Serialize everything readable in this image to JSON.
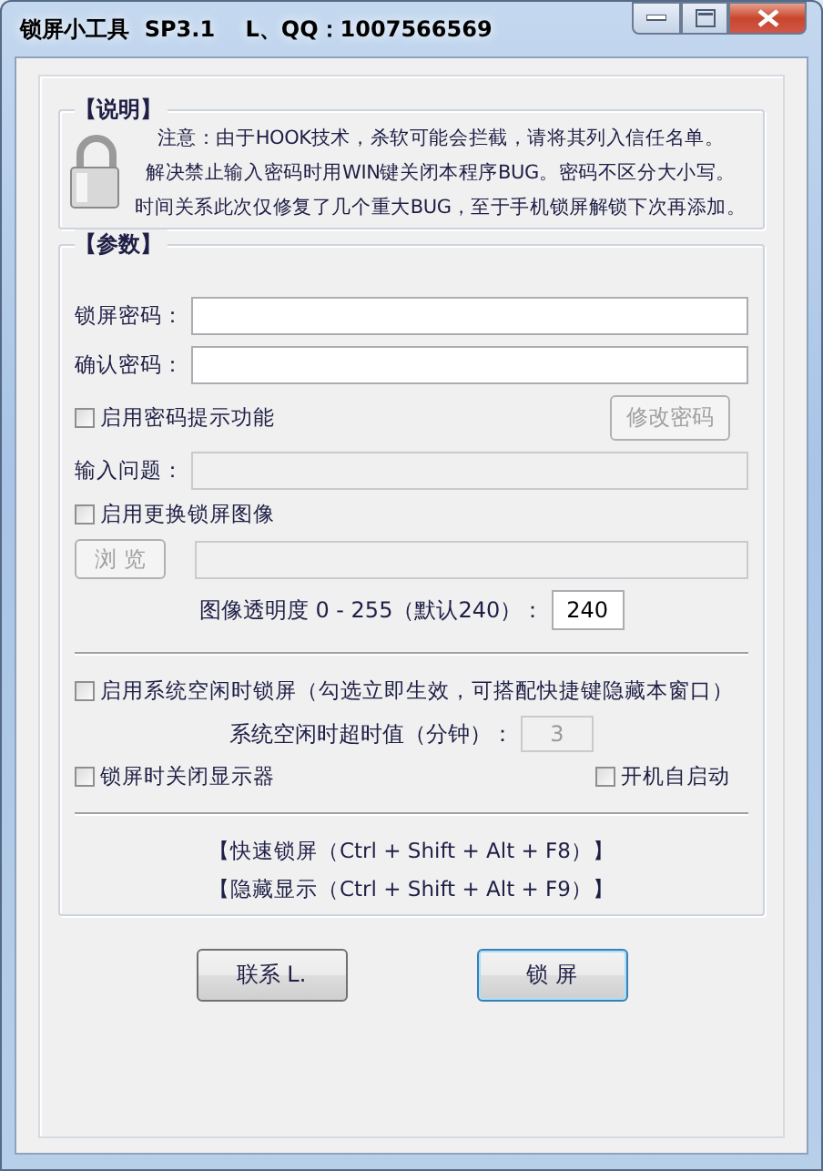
{
  "window": {
    "title": "锁屏小工具  SP3.1    L、QQ：1007566569"
  },
  "about": {
    "title": "【说明】",
    "lines": [
      "注意：由于HOOK技术，杀软可能会拦截，请将其列入信任名单。",
      "解决禁止输入密码时用WIN键关闭本程序BUG。密码不区分大小写。",
      "时间关系此次仅修复了几个重大BUG，至于手机锁屏解锁下次再添加。"
    ]
  },
  "params": {
    "title": "【参数】",
    "password_field": {
      "label": "锁屏密码：",
      "disabled": false
    },
    "confirm_field": {
      "label": "确认密码：",
      "disabled": false
    },
    "hint_option": {
      "label": "启用密码提示功能",
      "checked": false
    },
    "change_password_button": {
      "label": "修改密码",
      "disabled": true
    },
    "question_field": {
      "label": "输入问题：",
      "disabled": true
    },
    "image_option": {
      "label": "启用更换锁屏图像",
      "checked": false
    },
    "browse_button": {
      "label": "浏 览",
      "disabled": true
    },
    "image_path_field": {
      "disabled": true
    },
    "opacity": {
      "label": "图像透明度 0 - 255（默认240）：",
      "value": "240",
      "disabled": false
    },
    "idle_option": {
      "label": "启用系统空闲时锁屏（勾选立即生效，可搭配快捷键隐藏本窗口）",
      "checked": false
    },
    "idle_timeout": {
      "label": "系统空闲时超时值（分钟）：",
      "value": "3",
      "disabled": true
    },
    "monitor_off_option": {
      "label": "锁屏时关闭显示器",
      "checked": false
    },
    "autostart_option": {
      "label": "开机自启动",
      "checked": false
    },
    "hotkeys": [
      "【快速锁屏（Ctrl + Shift + Alt + F8）】",
      "【隐藏显示（Ctrl + Shift + Alt + F9）】"
    ]
  },
  "buttons": [
    {
      "label": "联系 L.",
      "default": false
    },
    {
      "label": "锁 屏",
      "default": true
    }
  ]
}
